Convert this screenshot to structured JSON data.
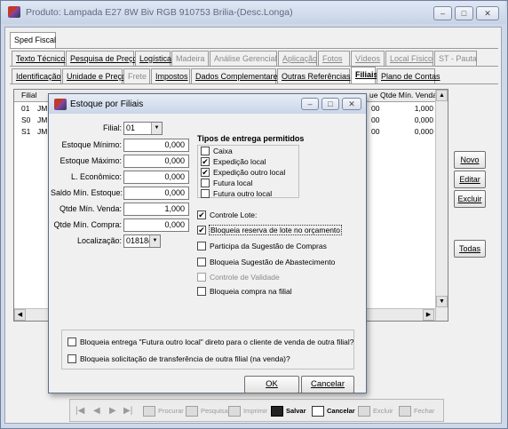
{
  "window": {
    "title": "Produto: Lampada E27 8W Biv RGB 910753 Brilia-(Desc.Longa)"
  },
  "tabs_row1": [
    {
      "label": "Sped Fiscal",
      "enabled": true,
      "selected": true
    }
  ],
  "tabs_row2": [
    {
      "label": "Texto Técnico",
      "enabled": true
    },
    {
      "label": "Pesquisa de Preço",
      "enabled": true
    },
    {
      "label": "Logística",
      "enabled": true
    },
    {
      "label": "Madeira",
      "enabled": false
    },
    {
      "label": "Análise Gerencial",
      "enabled": false
    },
    {
      "label": "Aplicação",
      "enabled": false
    },
    {
      "label": "Fotos",
      "enabled": false
    },
    {
      "label": "Vídeos",
      "enabled": false
    },
    {
      "label": "Local Físico",
      "enabled": false
    },
    {
      "label": "ST - Pauta",
      "enabled": false
    }
  ],
  "tabs_row3": [
    {
      "label": "Identificação",
      "enabled": true
    },
    {
      "label": "Unidade e Preço",
      "enabled": true
    },
    {
      "label": "Frete",
      "enabled": false
    },
    {
      "label": "Impostos",
      "enabled": true
    },
    {
      "label": "Dados Complementares",
      "enabled": true
    },
    {
      "label": "Outras Referências",
      "enabled": true
    },
    {
      "label": "Filiais",
      "enabled": true,
      "selected": true
    },
    {
      "label": "Plano de Contas",
      "enabled": true
    }
  ],
  "grid": {
    "col_filial": "Filial",
    "col_partial": "ue",
    "col_min_venda": "Qtde Mín. Venda",
    "rows": [
      {
        "filial": "01",
        "name": "JM",
        "partial": "00",
        "min_venda": "1,000"
      },
      {
        "filial": "S0",
        "name": "JM",
        "partial": "00",
        "min_venda": "0,000"
      },
      {
        "filial": "S1",
        "name": "JM",
        "partial": "00",
        "min_venda": "0,000"
      }
    ]
  },
  "side_buttons": {
    "novo": "Novo",
    "editar": "Editar",
    "excluir": "Excluir",
    "todas": "Todas"
  },
  "toolbar": {
    "procurar": "Procurar",
    "pesquisa": "Pesquisa",
    "imprimir": "Imprimir",
    "salvar": "Salvar",
    "cancelar": "Cancelar",
    "excluir": "Excluir",
    "fechar": "Fechar"
  },
  "dialog": {
    "title": "Estoque por Filiais",
    "filial_label": "Filial:",
    "filial_value": "01",
    "fields": [
      {
        "label": "Estoque Mínimo:",
        "value": "0,000"
      },
      {
        "label": "Estoque Máximo:",
        "value": "0,000"
      },
      {
        "label": "L. Econômico:",
        "value": "0,000"
      },
      {
        "label": "Saldo Mín. Estoque:",
        "value": "0,000"
      },
      {
        "label": "Qtde Mín. Venda:",
        "value": "1,000"
      },
      {
        "label": "Qtde Mín. Compra:",
        "value": "0,000"
      }
    ],
    "localizacao_label": "Localização:",
    "localizacao_value": "01818(",
    "entrega_title": "Tipos de entrega permitidos",
    "entrega": [
      {
        "label": "Caixa",
        "checked": false
      },
      {
        "label": "Expedição local",
        "checked": true
      },
      {
        "label": "Expedição outro local",
        "checked": true
      },
      {
        "label": "Futura local",
        "checked": false
      },
      {
        "label": "Futura outro local",
        "checked": false
      }
    ],
    "options": [
      {
        "label": "Controle Lote:",
        "checked": true,
        "enabled": true
      },
      {
        "label": "Bloqueia reserva de lote no orçamento",
        "checked": true,
        "enabled": true
      },
      {
        "label": "Participa da Sugestão de Compras",
        "checked": false,
        "enabled": true
      },
      {
        "label": "Bloqueia Sugestão de Abastecimento",
        "checked": false,
        "enabled": true
      },
      {
        "label": "Controle de Validade",
        "checked": false,
        "enabled": false
      },
      {
        "label": "Bloqueia compra na filial",
        "checked": false,
        "enabled": true
      }
    ],
    "bottom_options": [
      {
        "label": "Bloqueia entrega \"Futura outro local\" direto para o cliente de venda de outra filial?",
        "checked": false
      },
      {
        "label": "Bloqueia solicitação de transferência de outra filial (na venda)?",
        "checked": false
      }
    ],
    "ok": "OK",
    "cancelar": "Cancelar"
  }
}
